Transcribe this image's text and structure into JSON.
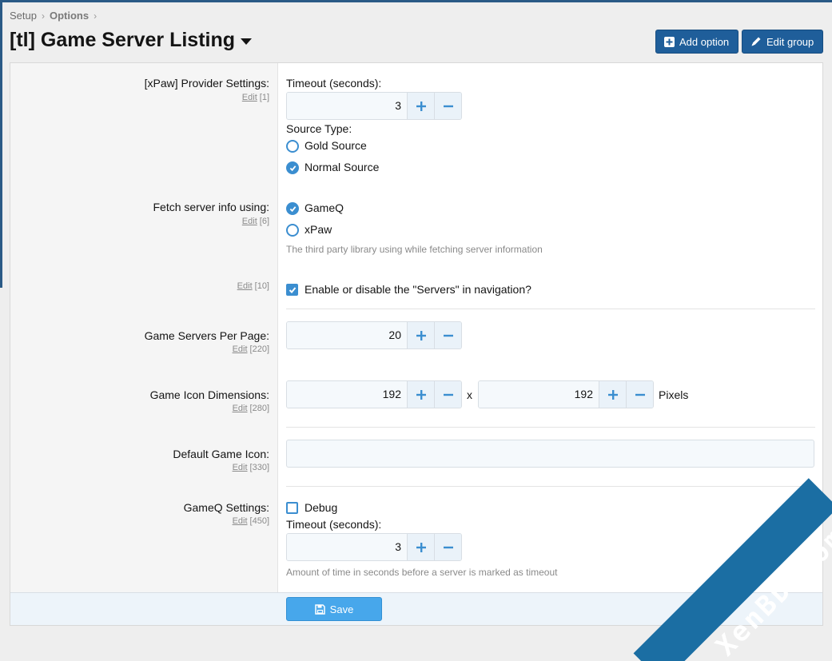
{
  "breadcrumb": {
    "item1": "Setup",
    "item2": "Options"
  },
  "page": {
    "title": "[tl] Game Server Listing"
  },
  "header_buttons": {
    "add_option": "Add option",
    "edit_group": "Edit group"
  },
  "options": {
    "xpaw": {
      "label": "[xPaw] Provider Settings:",
      "edit": "Edit",
      "order": "[1]",
      "timeout_label": "Timeout (seconds):",
      "timeout_value": "3",
      "source_type_label": "Source Type:",
      "source_options": [
        "Gold Source",
        "Normal Source"
      ],
      "source_selected": "Normal Source"
    },
    "fetch": {
      "label": "Fetch server info using:",
      "edit": "Edit",
      "order": "[6]",
      "options": [
        "GameQ",
        "xPaw"
      ],
      "selected": "GameQ",
      "hint": "The third party library using while fetching server information"
    },
    "navigation": {
      "edit": "Edit",
      "order": "[10]",
      "checkbox_label": "Enable or disable the \"Servers\" in navigation?",
      "checked": true
    },
    "per_page": {
      "label": "Game Servers Per Page:",
      "edit": "Edit",
      "order": "[220]",
      "value": "20"
    },
    "icon_dims": {
      "label": "Game Icon Dimensions:",
      "edit": "Edit",
      "order": "[280]",
      "width": "192",
      "height": "192",
      "separator": "x",
      "unit": "Pixels"
    },
    "default_icon": {
      "label": "Default Game Icon:",
      "edit": "Edit",
      "order": "[330]",
      "value": ""
    },
    "gameq": {
      "label": "GameQ Settings:",
      "edit": "Edit",
      "order": "[450]",
      "debug_label": "Debug",
      "debug_checked": false,
      "timeout_label": "Timeout (seconds):",
      "timeout_value": "3",
      "hint": "Amount of time in seconds before a server is marked as timeout"
    }
  },
  "footer": {
    "save_label": "Save"
  },
  "watermark": "XenBD.Com",
  "colors": {
    "accent": "#3b8ed0",
    "header_button": "#1f5e9a",
    "save_button": "#47a7eb"
  }
}
